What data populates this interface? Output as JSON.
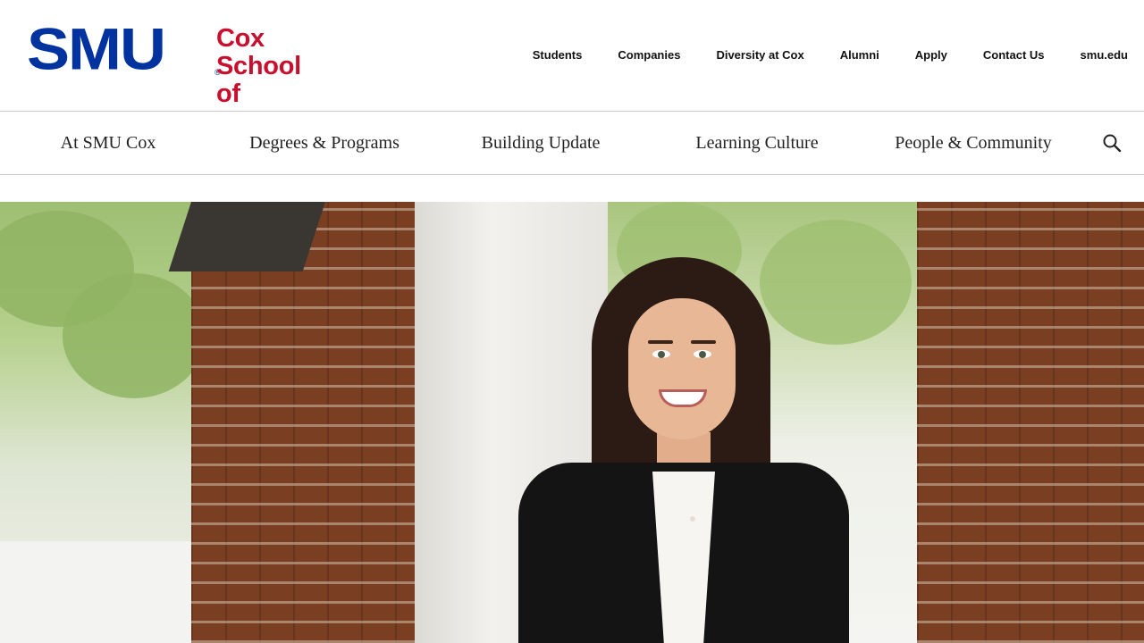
{
  "logo": {
    "brand": "SMU",
    "registered_mark": "®",
    "school_line1": "Cox School",
    "school_line2": "of Business"
  },
  "utility_nav": [
    {
      "label": "Students"
    },
    {
      "label": "Companies"
    },
    {
      "label": "Diversity at Cox"
    },
    {
      "label": "Alumni"
    },
    {
      "label": "Apply"
    },
    {
      "label": "Contact Us"
    },
    {
      "label": "smu.edu"
    }
  ],
  "main_nav": [
    {
      "label": "At SMU Cox"
    },
    {
      "label": "Degrees & Programs"
    },
    {
      "label": "Building Update"
    },
    {
      "label": "Learning Culture"
    },
    {
      "label": "People & Community"
    }
  ],
  "search": {
    "icon": "search-icon"
  },
  "colors": {
    "smu_blue": "#0033a0",
    "cox_red": "#c8102e",
    "nav_text": "#222222",
    "divider": "#c9c9c9"
  }
}
